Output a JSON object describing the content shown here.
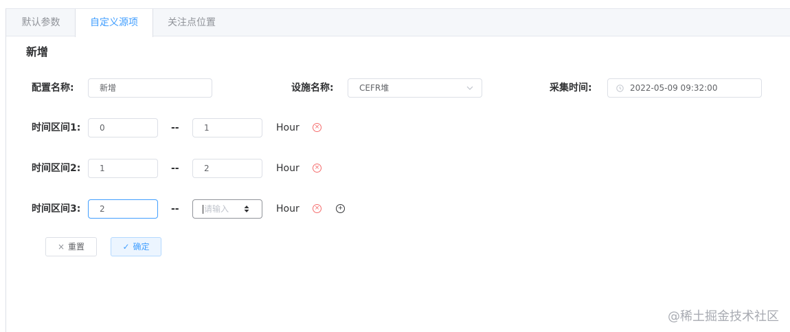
{
  "tabs": [
    {
      "label": "默认参数",
      "active": false
    },
    {
      "label": "自定义源项",
      "active": true
    },
    {
      "label": "关注点位置",
      "active": false
    }
  ],
  "form": {
    "title": "新增",
    "config_name_label": "配置名称:",
    "config_name_value": "新增",
    "facility_label": "设施名称:",
    "facility_value": "CEFR堆",
    "time_label": "采集时间:",
    "time_value": "2022-05-09 09:32:00",
    "intervals": [
      {
        "label": "时间区间1:",
        "start": "0",
        "end": "1",
        "unit": "Hour"
      },
      {
        "label": "时间区间2:",
        "start": "1",
        "end": "2",
        "unit": "Hour"
      },
      {
        "label": "时间区间3:",
        "start": "2",
        "end": "",
        "end_placeholder": "请输入",
        "unit": "Hour"
      }
    ],
    "separator": "--",
    "reset_label": "重置",
    "confirm_label": "确定"
  },
  "icons": {
    "remove": "circle-close-icon",
    "add": "circle-plus-icon",
    "clock": "clock-icon",
    "chevron": "chevron-down-icon",
    "stepper": "stepper-icon",
    "reset": "close-icon",
    "confirm": "check-icon"
  },
  "colors": {
    "accent": "#409eff",
    "danger": "#f56c6c",
    "border": "#dcdfe6"
  },
  "watermark": "@稀土掘金技术社区"
}
